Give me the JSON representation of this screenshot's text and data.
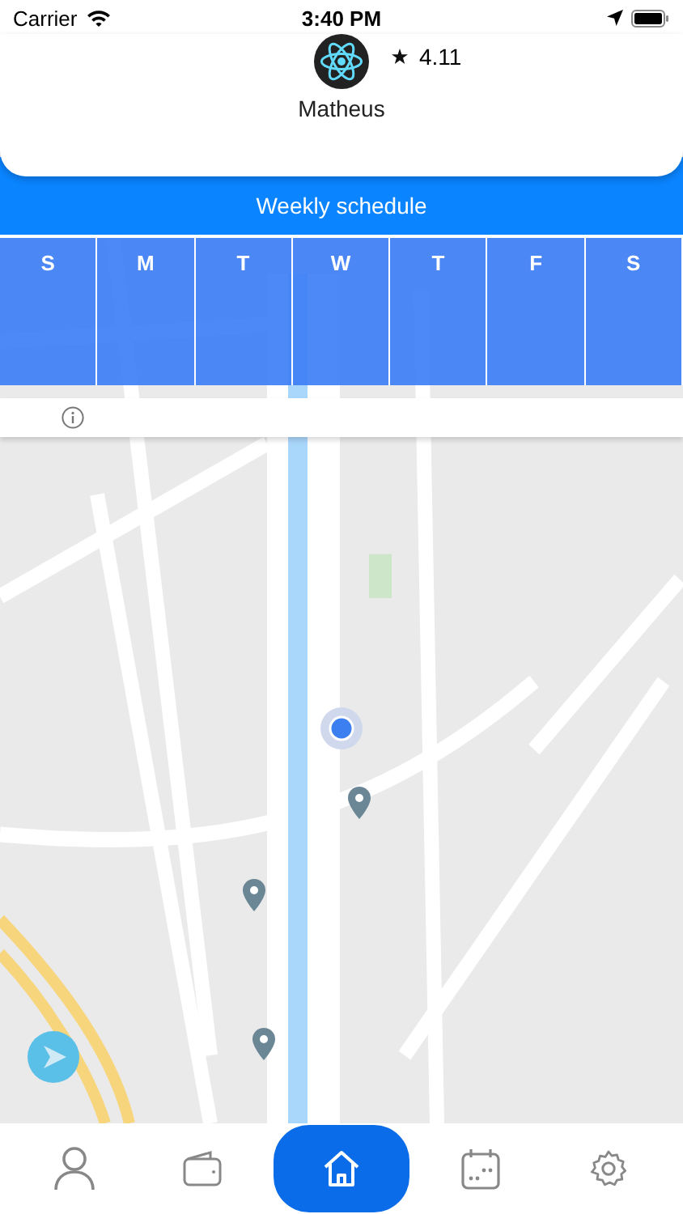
{
  "status_bar": {
    "carrier": "Carrier",
    "time": "3:40 PM"
  },
  "profile": {
    "rating": "4.11",
    "name": "Matheus"
  },
  "schedule": {
    "title": "Weekly schedule",
    "days": [
      {
        "label": "S"
      },
      {
        "label": "M"
      },
      {
        "label": "T"
      },
      {
        "label": "W"
      },
      {
        "label": "T"
      },
      {
        "label": "F"
      },
      {
        "label": "S"
      }
    ]
  },
  "tab_bar": [
    {
      "kind": "profile",
      "selected": false
    },
    {
      "kind": "wallet",
      "selected": false
    },
    {
      "kind": "home",
      "selected": true
    },
    {
      "kind": "calendar",
      "selected": false
    },
    {
      "kind": "settings",
      "selected": false
    }
  ]
}
